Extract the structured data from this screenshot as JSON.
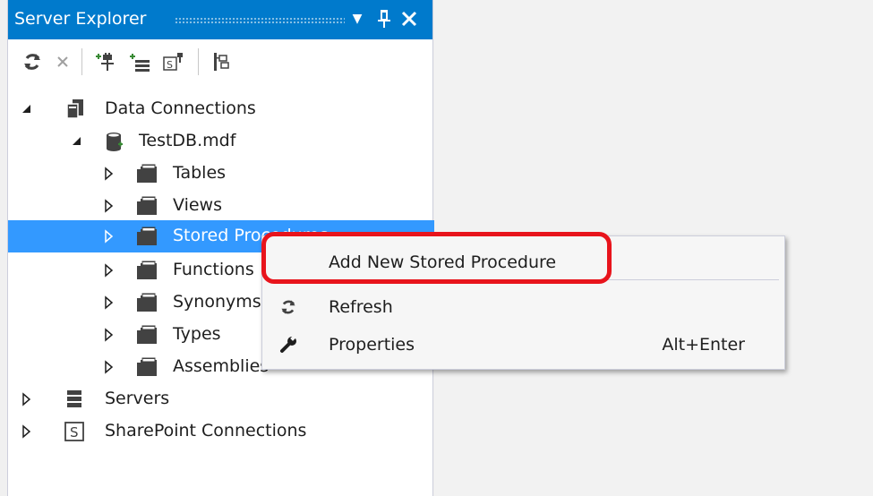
{
  "window": {
    "title": "Server Explorer",
    "buttons": {
      "dropdown": "▼",
      "pin": "🖈",
      "close": "✕"
    }
  },
  "toolbar": {
    "tools": [
      {
        "name": "refresh-icon"
      },
      {
        "name": "stop-icon"
      },
      {
        "name": "connect-to-database-icon"
      },
      {
        "name": "connect-to-server-icon"
      },
      {
        "name": "connect-to-sharepoint-icon"
      },
      {
        "name": "properties-icon"
      }
    ]
  },
  "tree": {
    "items": [
      {
        "label": "Data Connections",
        "expanded": true,
        "icon": "data-connections-icon"
      },
      {
        "label": "TestDB.mdf",
        "expanded": true,
        "icon": "database-icon"
      },
      {
        "label": "Tables",
        "expanded": false,
        "icon": "folder-icon"
      },
      {
        "label": "Views",
        "expanded": false,
        "icon": "folder-icon"
      },
      {
        "label": "Stored Procedures",
        "expanded": false,
        "icon": "folder-icon",
        "selected": true
      },
      {
        "label": "Functions",
        "expanded": false,
        "icon": "folder-icon"
      },
      {
        "label": "Synonyms",
        "expanded": false,
        "icon": "folder-icon"
      },
      {
        "label": "Types",
        "expanded": false,
        "icon": "folder-icon"
      },
      {
        "label": "Assemblies",
        "expanded": false,
        "icon": "folder-icon"
      },
      {
        "label": "Servers",
        "expanded": false,
        "icon": "servers-icon"
      },
      {
        "label": "SharePoint Connections",
        "expanded": false,
        "icon": "sharepoint-icon"
      }
    ]
  },
  "context_menu": {
    "items": [
      {
        "label": "Add New Stored Procedure",
        "icon": "",
        "shortcut": ""
      },
      {
        "label": "Refresh",
        "icon": "refresh-icon",
        "shortcut": ""
      },
      {
        "label": "Properties",
        "icon": "wrench-icon",
        "shortcut": "Alt+Enter"
      }
    ]
  },
  "colors": {
    "title_bar": "#007acc",
    "selection": "#3399ff",
    "highlight_ring": "#e8141c"
  }
}
